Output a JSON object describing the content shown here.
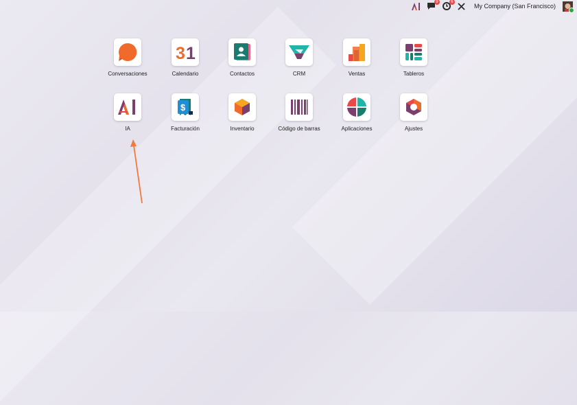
{
  "topbar": {
    "chat_badge": "9",
    "activity_badge": "6",
    "company": "My Company (San Francisco)"
  },
  "apps": [
    {
      "label": "Conversaciones",
      "icon": "discuss-icon"
    },
    {
      "label": "Calendario",
      "icon": "calendar-icon",
      "glyph": "31"
    },
    {
      "label": "Contactos",
      "icon": "contacts-icon"
    },
    {
      "label": "CRM",
      "icon": "crm-icon"
    },
    {
      "label": "Ventas",
      "icon": "sales-icon"
    },
    {
      "label": "Tableros",
      "icon": "dashboards-icon"
    },
    {
      "label": "IA",
      "icon": "ai-icon",
      "glyph": "AI"
    },
    {
      "label": "Facturación",
      "icon": "invoicing-icon",
      "glyph": "$"
    },
    {
      "label": "Inventario",
      "icon": "inventory-icon"
    },
    {
      "label": "Código de barras",
      "icon": "barcode-icon"
    },
    {
      "label": "Aplicaciones",
      "icon": "apps-icon"
    },
    {
      "label": "Ajustes",
      "icon": "settings-icon"
    }
  ],
  "colors": {
    "orange": "#f06b2b",
    "purple": "#7b3f6e",
    "teal": "#1fb5a8",
    "annotation_arrow": "#f07a3c"
  }
}
